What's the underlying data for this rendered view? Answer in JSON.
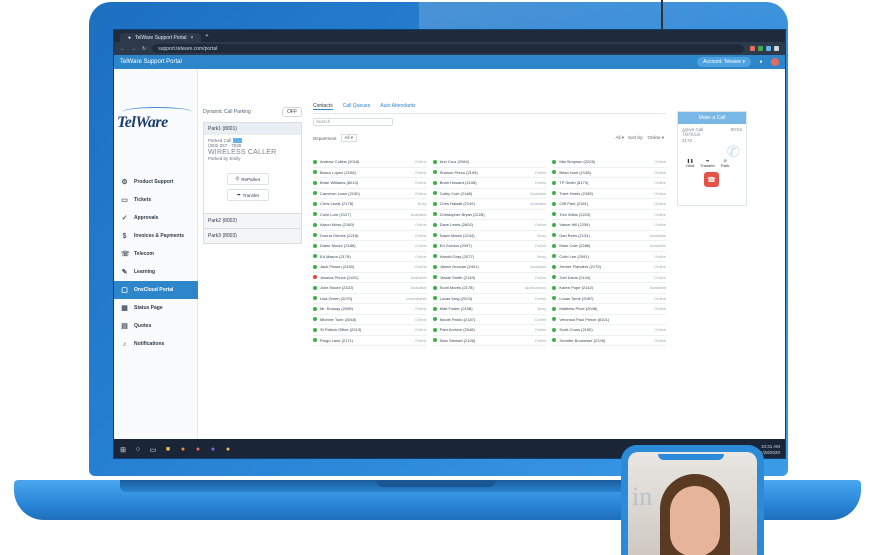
{
  "browser": {
    "tab_title": "TelWare Support Portal",
    "url": "support.telware.com/portal"
  },
  "header": {
    "title": "TelWare Support Portal",
    "account_label": "Account: Telware ▾"
  },
  "sidebar": {
    "logo": "TelWare",
    "items": [
      {
        "label": "Product Support",
        "icon": "gear-icon",
        "glyph": "⚙"
      },
      {
        "label": "Tickets",
        "icon": "ticket-icon",
        "glyph": "▭"
      },
      {
        "label": "Approvals",
        "icon": "approvals-icon",
        "glyph": "✓"
      },
      {
        "label": "Invoices & Payments",
        "icon": "dollar-icon",
        "glyph": "$"
      },
      {
        "label": "Telecom",
        "icon": "telecom-icon",
        "glyph": "☏"
      },
      {
        "label": "Learning",
        "icon": "graduation-icon",
        "glyph": "✎"
      },
      {
        "label": "OneCloud Portal",
        "icon": "cloud-icon",
        "glyph": "▢"
      },
      {
        "label": "Status Page",
        "icon": "status-icon",
        "glyph": "▦"
      },
      {
        "label": "Quotes",
        "icon": "quotes-icon",
        "glyph": "▤"
      },
      {
        "label": "Notifications",
        "icon": "bell-icon",
        "glyph": "♪"
      }
    ]
  },
  "call_panel": {
    "dynamic_label": "Dynamic Call Parking",
    "dynamic_state": "OFF",
    "park1_title": "Park1 (8001)",
    "parked_label": "Parked Call",
    "parked_number": "(303) 257 - 7530",
    "caller_name": "WIRELESS CALLER",
    "parked_by": "Parked by Emily",
    "retrieve_label": "ReParker",
    "transfer_label": "Transfer",
    "park2": "Park2 (8002)",
    "park3": "Park3 (8003)"
  },
  "contacts": {
    "tabs": [
      "Contacts",
      "Call Queues",
      "Auto Attendants"
    ],
    "search_placeholder": "Search",
    "filter_label": "Department",
    "filter_value": "All ▾",
    "all_label": "All ▾",
    "sort_label": "Sort by:",
    "sort_value": "Online ▾",
    "list": [
      {
        "name": "Andrew Collins (2018)",
        "status": "Online",
        "presence": "online"
      },
      {
        "name": "Ann Cruz (2084)",
        "status": "",
        "presence": "online"
      },
      {
        "name": "Mia Simpson (2025)",
        "status": "Online",
        "presence": "online"
      },
      {
        "name": "Bosco Lopez (2108)",
        "status": "Online",
        "presence": "online"
      },
      {
        "name": "Shanon Preco (2109)",
        "status": "Online",
        "presence": "online"
      },
      {
        "name": "Brian Hunt (2138)",
        "status": "Online",
        "presence": "online"
      },
      {
        "name": "Brian Williams (8013)",
        "status": "Online",
        "presence": "online"
      },
      {
        "name": "Brian Howard (2108)",
        "status": "Online",
        "presence": "online"
      },
      {
        "name": "TP Smith (8174)",
        "status": "Online",
        "presence": "online"
      },
      {
        "name": "Cameron Lowe (2150)",
        "status": "Online",
        "presence": "online"
      },
      {
        "name": "Cathy Cole (2148)",
        "status": "Available",
        "presence": "online"
      },
      {
        "name": "Trent Harris (2155)",
        "status": "Online",
        "presence": "online"
      },
      {
        "name": "Chris Lewis (2178)",
        "status": "Busy",
        "presence": "online"
      },
      {
        "name": "Chris Halsall (2149)",
        "status": "Available",
        "presence": "online"
      },
      {
        "name": "Cliff Park (2181)",
        "status": "Online",
        "presence": "online"
      },
      {
        "name": "Colin Lore (2127)",
        "status": "Available",
        "presence": "online"
      },
      {
        "name": "Christopher Bryan (2228)",
        "status": "",
        "presence": "online"
      },
      {
        "name": "Tom Wilds (2223)",
        "status": "Online",
        "presence": "online"
      },
      {
        "name": "Aaron Moss (2160)",
        "status": "Online",
        "presence": "online"
      },
      {
        "name": "Dave Lewis (2602)",
        "status": "Online",
        "presence": "online"
      },
      {
        "name": "Vance Hill (2239)",
        "status": "Online",
        "presence": "online"
      },
      {
        "name": "Donna Grimes (2218)",
        "status": "Online",
        "presence": "online"
      },
      {
        "name": "Dawn Marks (2244)",
        "status": "Busy",
        "presence": "online"
      },
      {
        "name": "Dan Rees (2134)",
        "status": "Available",
        "presence": "online"
      },
      {
        "name": "Diane Moore (2188)",
        "status": "Online",
        "presence": "online"
      },
      {
        "name": "Ed Gordon (2097)",
        "status": "Online",
        "presence": "online"
      },
      {
        "name": "Mark Cole (2288)",
        "status": "Available",
        "presence": "online"
      },
      {
        "name": "Ed Mason (2178)",
        "status": "Online",
        "presence": "online"
      },
      {
        "name": "Harold Gray (2077)",
        "status": "Busy",
        "presence": "online"
      },
      {
        "name": "Colin Lee (2091)",
        "status": "Online",
        "presence": "online"
      },
      {
        "name": "Jack Pinson (2430)",
        "status": "Online",
        "presence": "online"
      },
      {
        "name": "Janice Duncan (2401)",
        "status": "Available",
        "presence": "online"
      },
      {
        "name": "Jenner Flanders (2179)",
        "status": "Online",
        "presence": "online"
      },
      {
        "name": "Jessica Prince (2431)",
        "status": "Available",
        "presence": "busy"
      },
      {
        "name": "Jessie Smith (2149)",
        "status": "Online",
        "presence": "online"
      },
      {
        "name": "Joel Davis (2144)",
        "status": "Online",
        "presence": "online"
      },
      {
        "name": "Julie Moore (2322)",
        "status": "Available",
        "presence": "online"
      },
      {
        "name": "Scott Morris (2178)",
        "status": "Applications",
        "presence": "online"
      },
      {
        "name": "Karen Pope (2142)",
        "status": "Available",
        "presence": "online"
      },
      {
        "name": "Lisa Green (2070)",
        "status": "Unavailable",
        "presence": "online"
      },
      {
        "name": "Lucas King (2023)",
        "status": "Online",
        "presence": "online"
      },
      {
        "name": "Lucas Tomé (2087)",
        "status": "Online",
        "presence": "online"
      },
      {
        "name": "Mr. Rousay (2096)",
        "status": "Online",
        "presence": "online"
      },
      {
        "name": "Matt Foster (2158)",
        "status": "Busy",
        "presence": "online"
      },
      {
        "name": "Matthew Price (2048)",
        "status": "Online",
        "presence": "online"
      },
      {
        "name": "Michele Tone (2048)",
        "status": "Online",
        "presence": "online"
      },
      {
        "name": "Nicole Pardo (2187)",
        "status": "Online",
        "presence": "online"
      },
      {
        "name": "Veronica Paul Prince (8101)",
        "status": "",
        "presence": "online"
      },
      {
        "name": "St Patrick Office (2013)",
        "status": "Online",
        "presence": "online"
      },
      {
        "name": "Pam Archive (2048)",
        "status": "Online",
        "presence": "online"
      },
      {
        "name": "Scott Cross (2150)",
        "status": "Online",
        "presence": "online"
      },
      {
        "name": "Ringo Lane (2171)",
        "status": "Online",
        "presence": "online"
      },
      {
        "name": "Stan Stewart (2106)",
        "status": "Online",
        "presence": "online"
      },
      {
        "name": "Jennifer Bounesse (2128)",
        "status": "Online",
        "presence": "online"
      }
    ]
  },
  "call_widget": {
    "make_call": "Make a Call",
    "active_label": "Active Call",
    "timer": "00:04",
    "caller": "Teresa",
    "ext": "2172",
    "hold": "Hold",
    "transfer": "Transfer",
    "park": "Park"
  },
  "taskbar": {
    "time": "10:31 AM",
    "date": "1/28/2020"
  },
  "colors": {
    "brand_blue": "#2d86c9",
    "online": "#3fae49",
    "busy": "#e2453c",
    "hangup": "#e4524a"
  }
}
